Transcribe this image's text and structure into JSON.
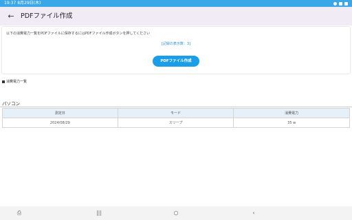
{
  "status_bar": {
    "time_date": "19:37  8月29日(木)"
  },
  "app_bar": {
    "title": "PDFファイル作成",
    "back_icon": "arrow-left"
  },
  "info": {
    "instruction": "以下の消費電力一覧をPDFファイルに保存するにはPDFファイル作成ボタンを押してください",
    "record_count": "[記録の表示数：3]",
    "button_label": "PDFファイル作成"
  },
  "section": {
    "title": "消費電力一覧"
  },
  "device": {
    "name": "パソコン"
  },
  "table": {
    "headers": [
      "測定日",
      "モード",
      "消費電力"
    ],
    "rows": [
      [
        "2024/08/29",
        "スリープ",
        "35 w"
      ]
    ]
  },
  "nav": {
    "screenshot": "⎙",
    "recent": "|||",
    "home": "○",
    "back": "‹"
  },
  "colors": {
    "status_bar": "#3aa8e8",
    "app_bar": "#f1ebf5",
    "button": "#1a9ee8",
    "table_header": "#e6f0f8"
  }
}
